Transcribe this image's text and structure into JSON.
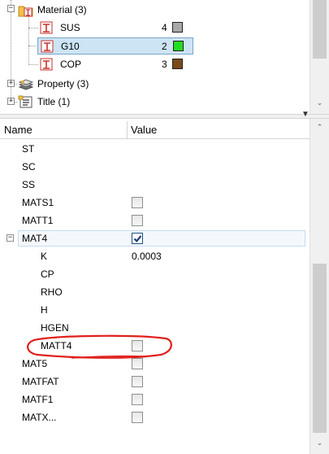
{
  "tree": {
    "material": {
      "label": "Material (3)",
      "expanded": true
    },
    "materials": [
      {
        "name": "SUS",
        "id": "4",
        "color": "#a9a9a9",
        "selected": false
      },
      {
        "name": "G10",
        "id": "2",
        "color": "#22dd22",
        "selected": true
      },
      {
        "name": "COP",
        "id": "3",
        "color": "#7a4a1a",
        "selected": false
      }
    ],
    "property": {
      "label": "Property (3)",
      "expanded": false
    },
    "title": {
      "label": "Title (1)",
      "expanded": false
    }
  },
  "grid": {
    "columns": {
      "name": "Name",
      "value": "Value"
    },
    "rows": {
      "st": {
        "name": "ST"
      },
      "sc": {
        "name": "SC"
      },
      "ss": {
        "name": "SS"
      },
      "mats1": {
        "name": "MATS1",
        "checked": false
      },
      "matt1": {
        "name": "MATT1",
        "checked": false
      },
      "mat4": {
        "name": "MAT4",
        "checked": true,
        "expanded": true
      },
      "k": {
        "name": "K",
        "value": "0.0003"
      },
      "cp": {
        "name": "CP"
      },
      "rho": {
        "name": "RHO"
      },
      "h": {
        "name": "H"
      },
      "hgen": {
        "name": "HGEN"
      },
      "matt4": {
        "name": "MATT4",
        "checked": false,
        "annotated": true
      },
      "mat5": {
        "name": "MAT5",
        "checked": false
      },
      "matfat": {
        "name": "MATFAT",
        "checked": false
      },
      "matf1": {
        "name": "MATF1",
        "checked": false
      },
      "matx": {
        "name": "MATX...",
        "checked": false
      }
    }
  },
  "annotation": {
    "color": "#e0201c"
  },
  "icons": {
    "material": "material-folder-icon",
    "material_leaf": "material-icon",
    "property": "property-stack-icon",
    "title": "title-list-icon",
    "checkbox_checked": "checkmark-icon"
  }
}
